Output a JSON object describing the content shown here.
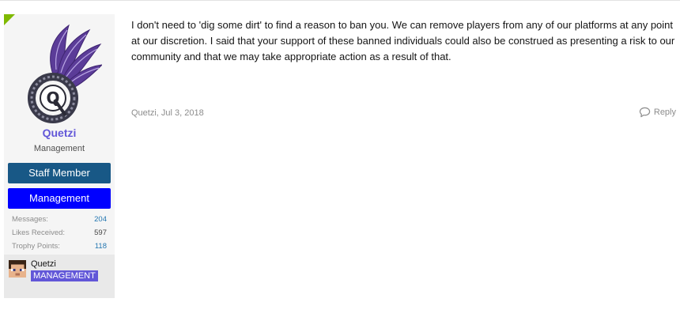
{
  "post": {
    "author": {
      "name": "Quetzi",
      "title": "Management",
      "banners": [
        "Staff Member",
        "Management"
      ],
      "stats": [
        {
          "label": "Messages:",
          "value": "204",
          "link": true
        },
        {
          "label": "Likes Received:",
          "value": "597",
          "link": false
        },
        {
          "label": "Trophy Points:",
          "value": "118",
          "link": true
        }
      ],
      "badge": {
        "name": "Quetzi",
        "rank": "MANAGEMENT"
      }
    },
    "message": "I don't need to 'dig some dirt' to find a reason to ban you. We can remove players from any of our platforms at any point at our discretion. I said that your support of these banned individuals could also be construed as presenting a risk to our community and that we may take appropriate action as a result of that.",
    "meta": "Quetzi, Jul 3, 2018",
    "reply_label": "Reply"
  },
  "icons": {
    "online": "online-indicator",
    "avatar": "winged-q-logo",
    "skin": "minecraft-head-icon",
    "reply": "speech-bubble-icon"
  },
  "colors": {
    "username": "#6257d8",
    "staff_banner": "#185886",
    "management_banner": "#0000ff",
    "rank_badge": "#6257d8",
    "link": "#2577b1",
    "online": "#7fb900"
  }
}
